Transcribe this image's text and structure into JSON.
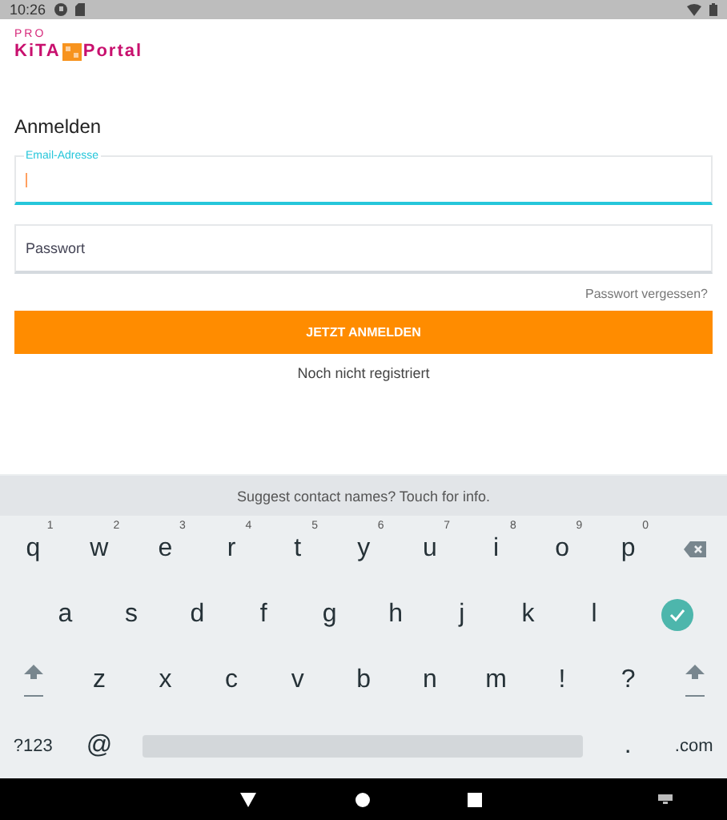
{
  "status_bar": {
    "time": "10:26"
  },
  "logo": {
    "top": "PRO",
    "left": "KiTA",
    "right": "Portal"
  },
  "login": {
    "title": "Anmelden",
    "fields": [
      {
        "label": "Email-Adresse",
        "focused": true
      },
      {
        "placeholder": "Passwort",
        "focused": false
      }
    ],
    "forgot_link": "Passwort vergessen?",
    "submit_button": "JETZT ANMELDEN",
    "register_link": "Noch nicht registriert"
  },
  "keyboard": {
    "suggestion": "Suggest contact names? Touch for info.",
    "rows": [
      [
        {
          "kind": "letter",
          "label": "q",
          "hint": "1"
        },
        {
          "kind": "letter",
          "label": "w",
          "hint": "2"
        },
        {
          "kind": "letter",
          "label": "e",
          "hint": "3"
        },
        {
          "kind": "letter",
          "label": "r",
          "hint": "4"
        },
        {
          "kind": "letter",
          "label": "t",
          "hint": "5"
        },
        {
          "kind": "letter",
          "label": "y",
          "hint": "6"
        },
        {
          "kind": "letter",
          "label": "u",
          "hint": "7"
        },
        {
          "kind": "letter",
          "label": "i",
          "hint": "8"
        },
        {
          "kind": "letter",
          "label": "o",
          "hint": "9"
        },
        {
          "kind": "letter",
          "label": "p",
          "hint": "0"
        },
        {
          "kind": "backspace"
        }
      ],
      [
        {
          "kind": "letter",
          "label": "a"
        },
        {
          "kind": "letter",
          "label": "s"
        },
        {
          "kind": "letter",
          "label": "d"
        },
        {
          "kind": "letter",
          "label": "f"
        },
        {
          "kind": "letter",
          "label": "g"
        },
        {
          "kind": "letter",
          "label": "h"
        },
        {
          "kind": "letter",
          "label": "j"
        },
        {
          "kind": "letter",
          "label": "k"
        },
        {
          "kind": "letter",
          "label": "l"
        },
        {
          "kind": "enter"
        }
      ],
      [
        {
          "kind": "shift"
        },
        {
          "kind": "letter",
          "label": "z"
        },
        {
          "kind": "letter",
          "label": "x"
        },
        {
          "kind": "letter",
          "label": "c"
        },
        {
          "kind": "letter",
          "label": "v"
        },
        {
          "kind": "letter",
          "label": "b"
        },
        {
          "kind": "letter",
          "label": "n"
        },
        {
          "kind": "letter",
          "label": "m"
        },
        {
          "kind": "letter",
          "label": "!"
        },
        {
          "kind": "letter",
          "label": "?"
        },
        {
          "kind": "shift"
        }
      ]
    ],
    "bottom_row": {
      "symbols_key": "?123",
      "at_key": "@",
      "period_key": ".",
      "domain_key": ".com"
    }
  }
}
